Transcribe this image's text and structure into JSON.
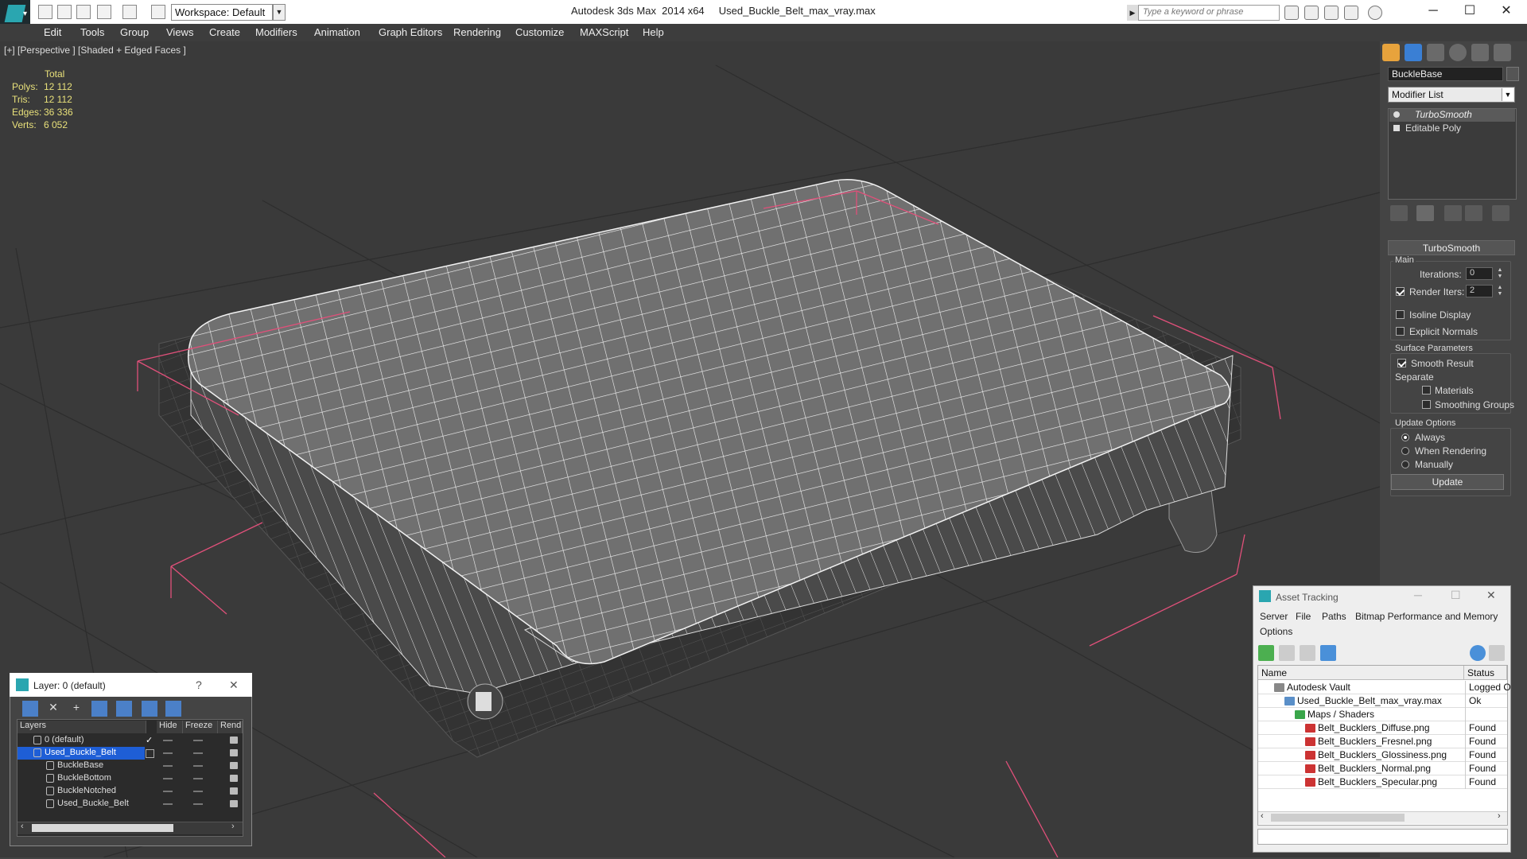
{
  "titlebar": {
    "workspace": "Workspace: Default",
    "app_name": "Autodesk 3ds Max  2014 x64",
    "file_name": "Used_Buckle_Belt_max_vray.max",
    "search_placeholder": "Type a keyword or phrase",
    "minimize": "─",
    "maximize": "☐",
    "close": "✕"
  },
  "menu": [
    "Edit",
    "Tools",
    "Group",
    "Views",
    "Create",
    "Modifiers",
    "Animation",
    "Graph Editors",
    "Rendering",
    "Customize",
    "MAXScript",
    "Help"
  ],
  "viewport": {
    "label": "[+] [Perspective ] [Shaded + Edged Faces ]",
    "stats": {
      "header": "Total",
      "rows": [
        {
          "label": "Polys:",
          "value": "12 112"
        },
        {
          "label": "Tris:",
          "value": "12 112"
        },
        {
          "label": "Edges:",
          "value": "36 336"
        },
        {
          "label": "Verts:",
          "value": "6 052"
        }
      ]
    }
  },
  "command_panel": {
    "object_name": "BuckleBase",
    "modifier_list": "Modifier List",
    "stack": [
      "TurboSmooth",
      "Editable Poly"
    ],
    "rollout_title": "TurboSmooth",
    "main_group": "Main",
    "iterations_label": "Iterations:",
    "iterations_value": "0",
    "render_iters_label": "Render Iters:",
    "render_iters_value": "2",
    "render_iters_checked": true,
    "isoline_display": "Isoline Display",
    "explicit_normals": "Explicit Normals",
    "surface_params_group": "Surface Parameters",
    "smooth_result": "Smooth Result",
    "separate_label": "Separate",
    "materials": "Materials",
    "smoothing_groups": "Smoothing Groups",
    "update_options_group": "Update Options",
    "always": "Always",
    "when_rendering": "When Rendering",
    "manually": "Manually",
    "update_button": "Update"
  },
  "layer_dialog": {
    "title": "Layer: 0 (default)",
    "help": "?",
    "close": "✕",
    "columns": [
      "Layers",
      "Hide",
      "Freeze",
      "Rend"
    ],
    "rows": [
      {
        "name": "0 (default)",
        "level": 0
      },
      {
        "name": "Used_Buckle_Belt",
        "level": 0
      },
      {
        "name": "BuckleBase",
        "level": 1
      },
      {
        "name": "BuckleBottom",
        "level": 1
      },
      {
        "name": "BuckleNotched",
        "level": 1
      },
      {
        "name": "Used_Buckle_Belt",
        "level": 1
      }
    ]
  },
  "asset_tracking": {
    "title": "Asset Tracking",
    "menu": [
      "Server",
      "File",
      "Paths",
      "Bitmap Performance and Memory",
      "Options"
    ],
    "columns": [
      "Name",
      "Status"
    ],
    "rows": [
      {
        "name": "Autodesk Vault",
        "status": "Logged O",
        "level": 0,
        "icon": "vault-icon"
      },
      {
        "name": "Used_Buckle_Belt_max_vray.max",
        "status": "Ok",
        "level": 1,
        "icon": "max-file-icon"
      },
      {
        "name": "Maps / Shaders",
        "status": "",
        "level": 2,
        "icon": "maps-icon"
      },
      {
        "name": "Belt_Bucklers_Diffuse.png",
        "status": "Found",
        "level": 3,
        "icon": "png-icon"
      },
      {
        "name": "Belt_Bucklers_Fresnel.png",
        "status": "Found",
        "level": 3,
        "icon": "png-icon"
      },
      {
        "name": "Belt_Bucklers_Glossiness.png",
        "status": "Found",
        "level": 3,
        "icon": "png-icon"
      },
      {
        "name": "Belt_Bucklers_Normal.png",
        "status": "Found",
        "level": 3,
        "icon": "png-icon"
      },
      {
        "name": "Belt_Bucklers_Specular.png",
        "status": "Found",
        "level": 3,
        "icon": "png-icon"
      }
    ]
  },
  "colors": {
    "viewport_bg": "#3a3a3a",
    "wire": "#f2f2f2",
    "bbox": "#e0507a",
    "stats": "#e8e07a",
    "selection": "#1e5ed6"
  }
}
